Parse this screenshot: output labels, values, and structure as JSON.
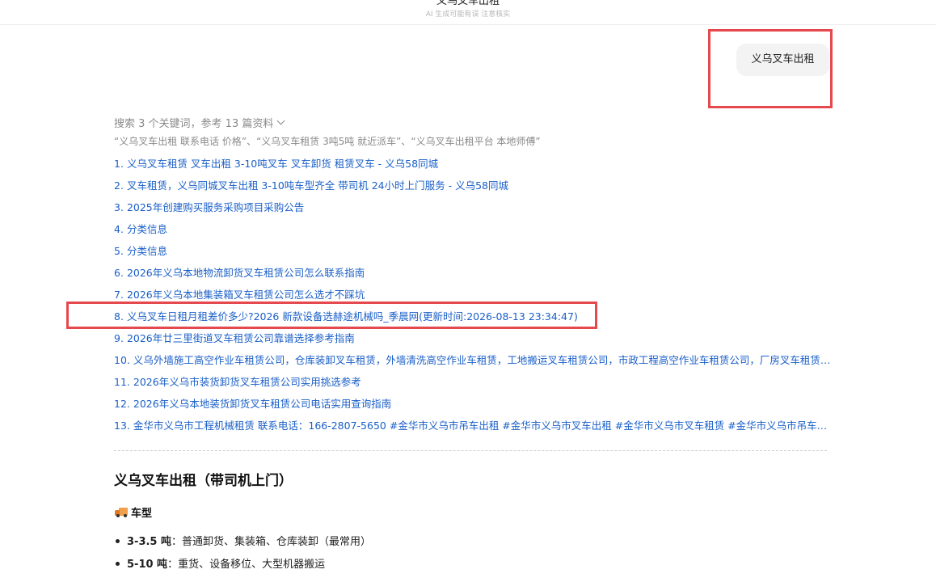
{
  "header": {
    "title": "义乌叉车出租",
    "subtitle": "AI 生成可能有误 注意核实"
  },
  "user_message": "义乌叉车出租",
  "search": {
    "summary": "搜索 3 个关键词，参考 13 篇资料",
    "keywords": "“义乌叉车出租 联系电话 价格”、“义乌叉车租赁 3吨5吨 就近派车”、“义乌叉车出租平台 本地师傅”"
  },
  "references": [
    {
      "num": "1.",
      "text": "义乌叉车租赁 叉车出租 3-10吨叉车 叉车卸货 租赁叉车 - 义乌58同城"
    },
    {
      "num": "2.",
      "text": "叉车租赁，义乌同城叉车出租 3-10吨车型齐全 带司机 24小时上门服务 - 义乌58同城"
    },
    {
      "num": "3.",
      "text": "2025年创建购买服务采购项目采购公告"
    },
    {
      "num": "4.",
      "text": "分类信息"
    },
    {
      "num": "5.",
      "text": "分类信息"
    },
    {
      "num": "6.",
      "text": "2026年义乌本地物流卸货叉车租赁公司怎么联系指南"
    },
    {
      "num": "7.",
      "text": "2026年义乌本地集装箱叉车租赁公司怎么选才不踩坑"
    },
    {
      "num": "8.",
      "text": "义乌叉车日租月租差价多少?2026 新款设备选赫途机械吗_季晨网(更新时间:2026-08-13 23:34:47)"
    },
    {
      "num": "9.",
      "text": "2026年廿三里街道叉车租赁公司靠谱选择参考指南"
    },
    {
      "num": "10.",
      "text": "义乌外墙施工高空作业车租赁公司，仓库装卸叉车租赁，外墙清洗高空作业车租赁，工地搬运叉车租赁公司，市政工程高空作业车租赁公司，厂房叉车租赁公司，物流园叉车租赁公司"
    },
    {
      "num": "11.",
      "text": "2026年义乌市装货卸货叉车租赁公司实用挑选参考"
    },
    {
      "num": "12.",
      "text": "2026年义乌本地装货卸货叉车租赁公司电话实用查询指南"
    },
    {
      "num": "13.",
      "text": "金华市义乌市工程机械租赁 联系电话：166-2807-5650 #金华市义乌市吊车出租 #金华市义乌市叉车出租 #金华市义乌市叉车租赁 #金华市义乌市吊车租赁"
    }
  ],
  "answer": {
    "title": "义乌叉车出租（带司机上门）",
    "section": "车型",
    "items": [
      {
        "bold": "3-3.5 吨",
        "text": "：普通卸货、集装箱、仓库装卸（最常用）"
      },
      {
        "bold": "5-10 吨",
        "text": "：重货、设备移位、大型机器搬运"
      }
    ]
  },
  "colors": {
    "link": "#1a5fc8",
    "highlight": "#e5484d"
  }
}
